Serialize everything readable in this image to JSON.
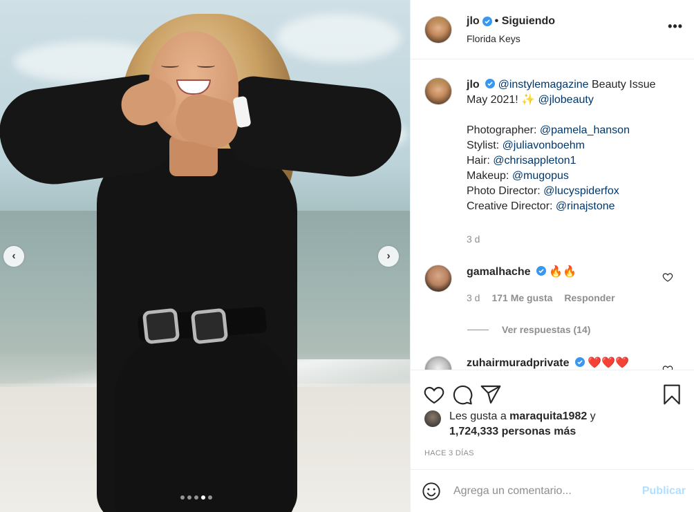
{
  "post": {
    "carousel": {
      "dot_count": 5,
      "active_index": 3
    },
    "author": {
      "username": "jlo",
      "following_label": "• Siguiendo",
      "location": "Florida Keys"
    },
    "caption": {
      "username": "jlo",
      "line1_mention": "@instylemagazine",
      "line1_text": " Beauty Issue",
      "line2_text": "May 2021! ✨ ",
      "line2_mention": "@jlobeauty",
      "credits": [
        {
          "label": "Photographer: ",
          "mention": "@pamela_hanson"
        },
        {
          "label": "Stylist: ",
          "mention": "@juliavonboehm"
        },
        {
          "label": "Hair: ",
          "mention": "@chrisappleton1"
        },
        {
          "label": "Makeup: ",
          "mention": "@mugopus"
        },
        {
          "label": "Photo Director: ",
          "mention": "@lucyspiderfox"
        },
        {
          "label": "Creative Director: ",
          "mention": "@rinajstone"
        }
      ],
      "time": "3 d"
    },
    "comments": [
      {
        "username": "gamalhache",
        "text": "🔥🔥",
        "time": "3 d",
        "likes": "171 Me gusta",
        "reply": "Responder"
      },
      {
        "username": "zuhairmuradprivate",
        "text": "❤️❤️❤️"
      }
    ],
    "view_replies": "Ver respuestas (14)",
    "likes": {
      "prefix": "Les gusta a ",
      "user": "maraquita1982",
      "mid": " y",
      "count": "1,724,333 personas más"
    },
    "timestamp": "HACE 3 DÍAS",
    "add_comment": {
      "placeholder": "Agrega un comentario...",
      "publish": "Publicar"
    }
  },
  "colors": {
    "link": "#00376b",
    "muted": "#8e8e8e",
    "verified": "#3897f0",
    "publish_disabled": "#b2dffc"
  },
  "icons": [
    "chevron-left-icon",
    "chevron-right-icon",
    "verified-icon",
    "more-icon",
    "heart-icon",
    "comment-icon",
    "share-icon",
    "bookmark-icon",
    "emoji-icon"
  ]
}
